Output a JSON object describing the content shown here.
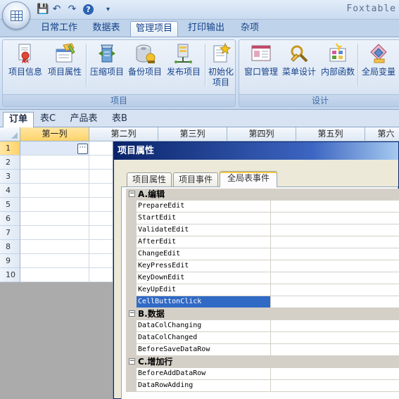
{
  "app": {
    "title": "Foxtable"
  },
  "qat": [
    {
      "name": "save-icon",
      "glyph": "💾"
    },
    {
      "name": "undo-icon",
      "glyph": "↶"
    },
    {
      "name": "redo-icon",
      "glyph": "↷"
    },
    {
      "name": "help-icon",
      "glyph": "?"
    },
    {
      "name": "customize-qat-icon",
      "glyph": "▾"
    }
  ],
  "ribbon_tabs": [
    "日常工作",
    "数据表",
    "管理项目",
    "打印输出",
    "杂项"
  ],
  "ribbon_active_tab": "管理项目",
  "ribbon_groups": [
    {
      "label": "项目",
      "buttons": [
        {
          "label": "项目信息",
          "icon": "project-info-icon"
        },
        {
          "label": "项目属性",
          "icon": "project-properties-icon"
        },
        {
          "label": "压缩项目",
          "icon": "compress-project-icon"
        },
        {
          "label": "备份项目",
          "icon": "backup-project-icon"
        },
        {
          "label": "发布项目",
          "icon": "publish-project-icon"
        },
        {
          "label": "初始化\n项目",
          "icon": "initialize-project-icon"
        }
      ]
    },
    {
      "label": "设计",
      "buttons": [
        {
          "label": "窗口管理",
          "icon": "window-manager-icon"
        },
        {
          "label": "菜单设计",
          "icon": "menu-design-icon"
        },
        {
          "label": "内部函数",
          "icon": "internal-functions-icon"
        },
        {
          "label": "全局变量",
          "icon": "global-variables-icon"
        }
      ]
    }
  ],
  "sheet_tabs": [
    "订单",
    "表C",
    "产品表",
    "表B"
  ],
  "sheet_active": "订单",
  "grid": {
    "columns": [
      "第一列",
      "第二列",
      "第三列",
      "第四列",
      "第五列",
      "第六"
    ],
    "rows": [
      "1",
      "2",
      "3",
      "4",
      "5",
      "6",
      "7",
      "8",
      "9",
      "10"
    ],
    "cell_button": "⋯"
  },
  "dialog": {
    "title": "项目属性",
    "tabs": [
      "项目属性",
      "项目事件",
      "全局表事件"
    ],
    "active_tab": "全局表事件",
    "categories": [
      {
        "toggle": "−",
        "label": "A.编辑",
        "items": [
          "PrepareEdit",
          "StartEdit",
          "ValidateEdit",
          "AfterEdit",
          "ChangeEdit",
          "KeyPressEdit",
          "KeyDownEdit",
          "KeyUpEdit",
          "CellButtonClick"
        ]
      },
      {
        "toggle": "−",
        "label": "B.数据",
        "items": [
          "DataColChanging",
          "DataColChanged",
          "BeforeSaveDataRow"
        ]
      },
      {
        "toggle": "−",
        "label": "C.增加行",
        "items": [
          "BeforeAddDataRow",
          "DataRowAdding"
        ]
      }
    ],
    "selected_item": "CellButtonClick"
  },
  "colors": {
    "ribbon_text": "#15428b",
    "active_header": "#ffd36b",
    "selection": "#316ac5",
    "dialog_title": "#0a246a"
  }
}
